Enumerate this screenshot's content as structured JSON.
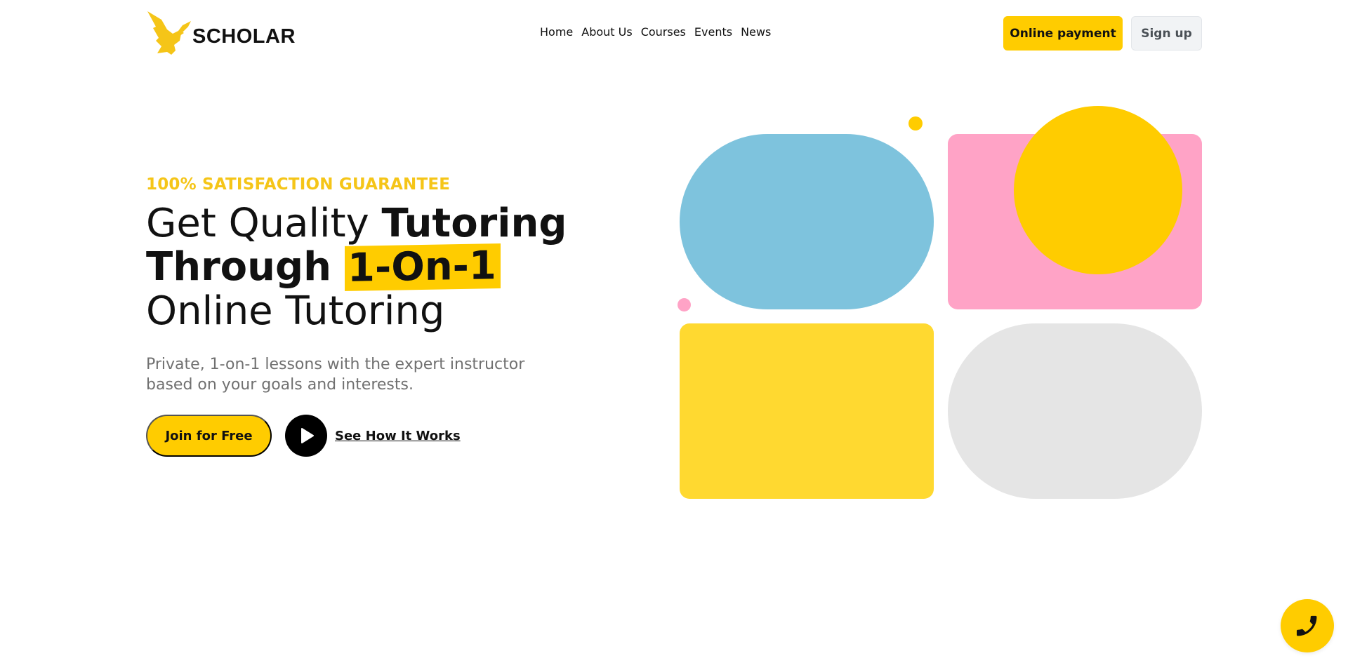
{
  "brand": {
    "name": "SCHOLAR",
    "logo_icon": "eagle-icon"
  },
  "nav": {
    "items": [
      "Home",
      "About Us",
      "Courses",
      "Events",
      "News"
    ]
  },
  "header": {
    "pay_label": "Online payment",
    "signup_label": "Sign up"
  },
  "hero": {
    "eyebrow": "100% SATISFACTION GUARANTEE",
    "line1_light": "Get Quality ",
    "line1_bold": "Tutoring",
    "line2_bold": "Through ",
    "line2_highlight": "1-On-1",
    "line3_light": "Online Tutoring",
    "lead": "Private, 1-on-1 lessons with the expert instructor based on your goals and interests.",
    "join_label": "Join for Free",
    "play_icon": "play-icon",
    "how_label": "See How It Works"
  },
  "fab": {
    "icon": "phone-icon"
  },
  "colors": {
    "accent": "#ffcc00",
    "blue": "#7ec3dd",
    "pink": "#ffa3c6",
    "yellow_soft": "#ffd930",
    "gray": "#e5e5e5"
  }
}
